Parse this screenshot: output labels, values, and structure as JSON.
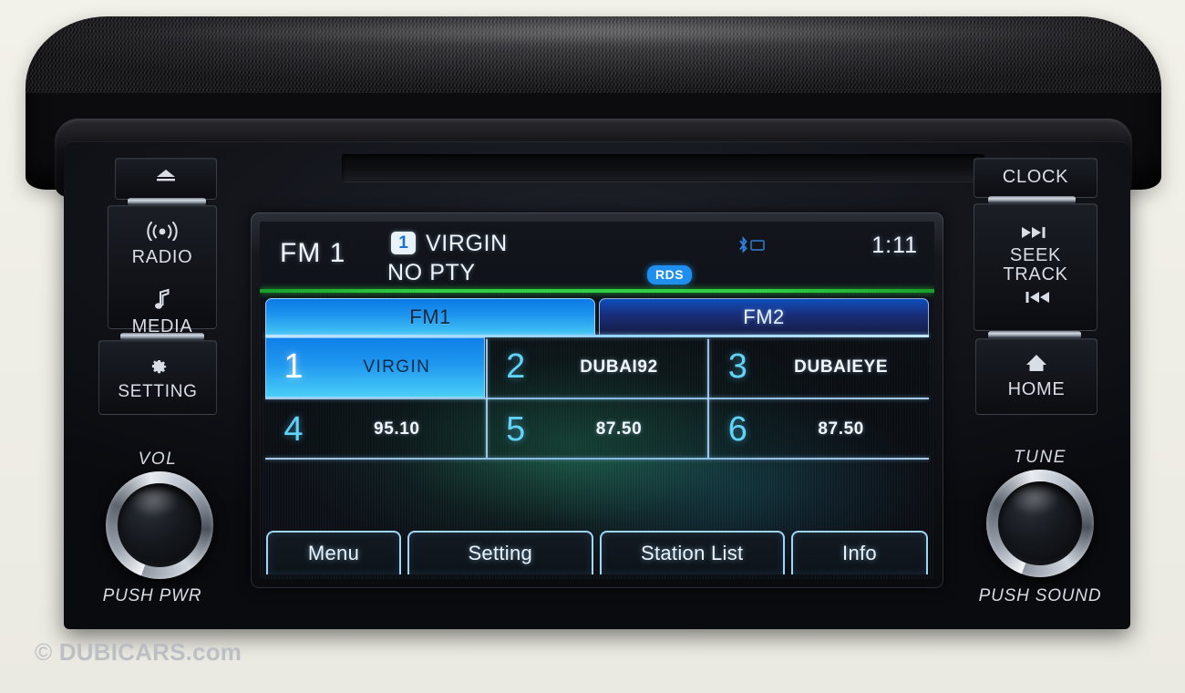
{
  "device": {
    "type": "car-infotainment-head-unit",
    "watermark": "DUBICARS.com",
    "watermark_copyright": "©"
  },
  "screen": {
    "header": {
      "band_label": "FM 1",
      "preset_number": "1",
      "station_name": "VIRGIN",
      "pty_text": "NO PTY",
      "rds_badge": "RDS",
      "bluetooth_icon": "bluetooth-icon",
      "phone_icon": "phone-signal-icon",
      "clock": "1:11",
      "divider_color": "#2fcf44"
    },
    "tabs": [
      {
        "label": "FM1",
        "active": true
      },
      {
        "label": "FM2",
        "active": false
      }
    ],
    "presets": [
      {
        "number": "1",
        "label": "VIRGIN",
        "selected": true
      },
      {
        "number": "2",
        "label": "DUBAI92",
        "selected": false
      },
      {
        "number": "3",
        "label": "DUBAIEYE",
        "selected": false
      },
      {
        "number": "4",
        "label": "95.10",
        "selected": false
      },
      {
        "number": "5",
        "label": "87.50",
        "selected": false
      },
      {
        "number": "6",
        "label": "87.50",
        "selected": false
      }
    ],
    "softkeys": [
      {
        "label": "Menu"
      },
      {
        "label": "Setting"
      },
      {
        "label": "Station List"
      },
      {
        "label": "Info"
      }
    ],
    "accent_colors": {
      "active_tab": "#1d93ee",
      "inactive_tab": "#1a2d78",
      "preset_number": "#62d3f7",
      "softkey_border": "#9fd6f6",
      "rds": "#1e8fef"
    }
  },
  "left_panel": {
    "eject_button": {
      "icon": "eject-icon"
    },
    "radio_button": {
      "icon": "radio-waves-icon",
      "label": "RADIO"
    },
    "media_button": {
      "icon": "music-note-icon",
      "label": "MEDIA"
    },
    "setting_button": {
      "icon": "gear-icon",
      "label": "SETTING"
    },
    "volume_knob": {
      "label": "VOL",
      "sub_label": "PUSH PWR"
    }
  },
  "right_panel": {
    "clock_button": {
      "label": "CLOCK"
    },
    "seek_track_button": {
      "icon_up": "seek-forward-icon",
      "label_line1": "SEEK",
      "label_line2": "TRACK",
      "icon_down": "seek-back-icon"
    },
    "home_button": {
      "icon": "home-icon",
      "label": "HOME"
    },
    "tune_knob": {
      "label": "TUNE",
      "sub_label": "PUSH SOUND"
    }
  }
}
